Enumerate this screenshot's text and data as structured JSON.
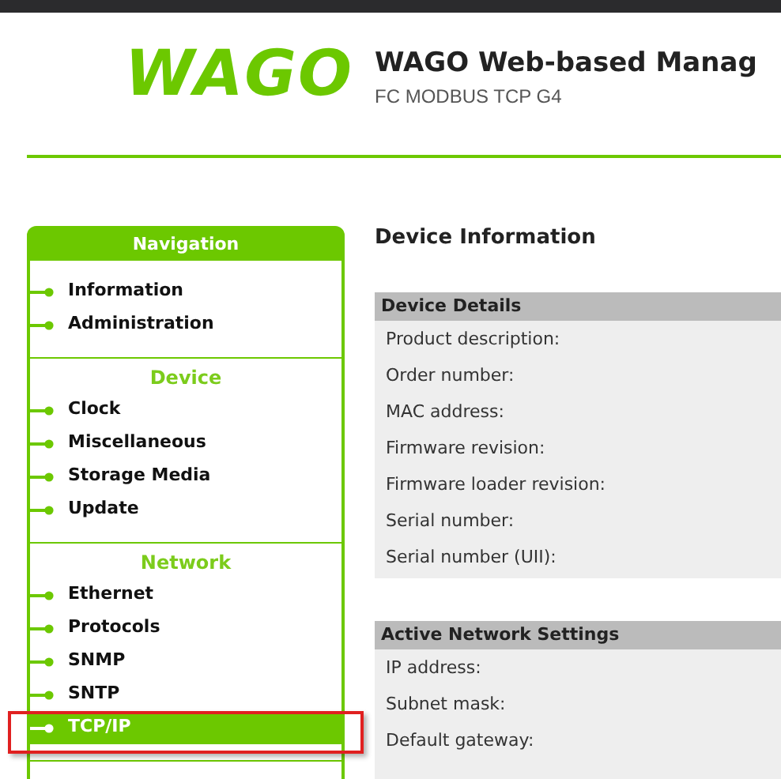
{
  "logo": "WAGO",
  "title": "WAGO Web-based Manag",
  "subtitle": "FC MODBUS TCP G4",
  "navigation": {
    "title": "Navigation",
    "sections": [
      {
        "items": [
          {
            "label": "Information",
            "selected": false,
            "highlighted": false
          },
          {
            "label": "Administration",
            "selected": false,
            "highlighted": false
          }
        ]
      },
      {
        "heading": "Device",
        "items": [
          {
            "label": "Clock",
            "selected": false,
            "highlighted": false
          },
          {
            "label": "Miscellaneous",
            "selected": false,
            "highlighted": false
          },
          {
            "label": "Storage Media",
            "selected": false,
            "highlighted": false
          },
          {
            "label": "Update",
            "selected": false,
            "highlighted": false
          }
        ]
      },
      {
        "heading": "Network",
        "items": [
          {
            "label": "Ethernet",
            "selected": false,
            "highlighted": false
          },
          {
            "label": "Protocols",
            "selected": false,
            "highlighted": false
          },
          {
            "label": "SNMP",
            "selected": false,
            "highlighted": false
          },
          {
            "label": "SNTP",
            "selected": false,
            "highlighted": false
          },
          {
            "label": "TCP/IP",
            "selected": true,
            "highlighted": true
          }
        ]
      }
    ]
  },
  "content": {
    "heading": "Device Information",
    "panels": [
      {
        "title": "Device Details",
        "rows": [
          "Product description:",
          "Order number:",
          "MAC address:",
          "Firmware revision:",
          "Firmware loader revision:",
          "Serial number:",
          "Serial number (UII):"
        ]
      },
      {
        "title": "Active Network Settings",
        "rows": [
          "IP address:",
          "Subnet mask:",
          "Default gateway:"
        ]
      }
    ]
  }
}
